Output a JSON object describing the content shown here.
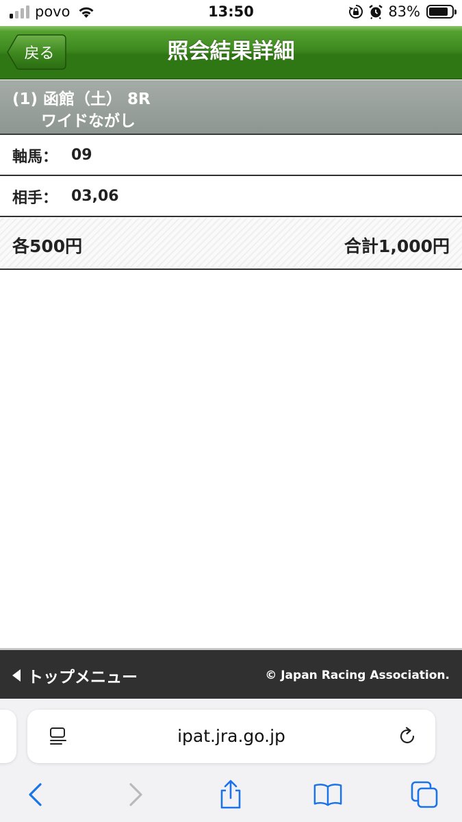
{
  "status_bar": {
    "carrier": "povo",
    "time": "13:50",
    "battery_percent": "83%",
    "battery_level": 0.83,
    "icons": [
      "signal-icon",
      "wifi-icon",
      "rotation-lock-icon",
      "alarm-icon",
      "battery-icon"
    ]
  },
  "header": {
    "back_label": "戻る",
    "title": "照会結果詳細"
  },
  "race": {
    "line1": "(1) 函館（土） 8R",
    "bet_type": "ワイドながし"
  },
  "details": {
    "axis_label": "軸馬：",
    "axis_value": "09",
    "partner_label": "相手：",
    "partner_value": "03,06"
  },
  "amount": {
    "each": "各500円",
    "total": "合計1,000円"
  },
  "footer": {
    "top_menu_label": "トップメニュー",
    "copyright": "© Japan Racing Association."
  },
  "safari": {
    "url": "ipat.jra.go.jp",
    "toolbar_icons": [
      "back-icon",
      "forward-icon",
      "share-icon",
      "bookmarks-icon",
      "tabs-icon"
    ]
  },
  "colors": {
    "header_green": "#3f8a20",
    "race_band_gray": "#979e9a",
    "footer_dark": "#303030",
    "ios_blue": "#1a73e8"
  }
}
